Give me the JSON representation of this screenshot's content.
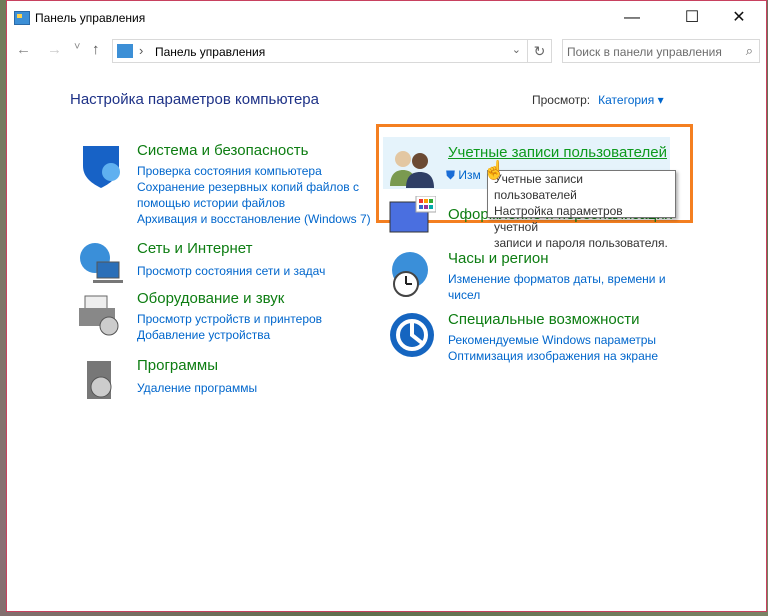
{
  "window": {
    "title": "Панель управления",
    "minimize": "—",
    "maximize": "☐",
    "close": "✕"
  },
  "nav": {
    "back": "←",
    "forward": "→",
    "recent": "˅",
    "up": "↑",
    "breadcrumb_sep": "›",
    "address": "Панель управления",
    "refresh": "↻",
    "dropdown": "⌄",
    "search_placeholder": "Поиск в панели управления"
  },
  "main": {
    "heading": "Настройка параметров компьютера",
    "view_label": "Просмотр:",
    "view_value": "Категория ▾"
  },
  "categories": [
    {
      "title": "Система и безопасность",
      "links": [
        "Проверка состояния компьютера",
        "Сохранение резервных копий файлов с",
        "помощью истории файлов",
        "Архивация и восстановление (Windows 7)"
      ]
    },
    {
      "title": "Сеть и Интернет",
      "links": [
        "Просмотр состояния сети и задач"
      ]
    },
    {
      "title": "Оборудование и звук",
      "links": [
        "Просмотр устройств и принтеров",
        "Добавление устройства"
      ]
    },
    {
      "title": "Программы",
      "links": [
        "Удаление программы"
      ]
    },
    {
      "title": "Учетные записи пользователей",
      "links": [
        "Изм"
      ]
    },
    {
      "title": "Оформление и персонализация",
      "links": []
    },
    {
      "title": "Часы и регион",
      "links": [
        "Изменение форматов даты, времени и",
        "чисел"
      ]
    },
    {
      "title": "Специальные возможности",
      "links": [
        "Рекомендуемые Windows параметры",
        "Оптимизация изображения на экране"
      ]
    }
  ],
  "tooltip": {
    "line1": "Учетные записи пользователей",
    "line2": "Настройка параметров учетной",
    "line3": "записи и пароля пользователя."
  },
  "colors": {
    "highlight": "#f47f20",
    "title_green": "#0d7d12",
    "link_blue": "#0066cc",
    "heading_blue": "#1e3287"
  }
}
